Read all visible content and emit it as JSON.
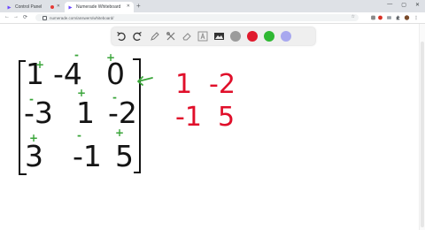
{
  "browser": {
    "tabs": [
      {
        "label": "Control Panel",
        "active": false,
        "recording": true
      },
      {
        "label": "Numerade Whiteboard",
        "active": true,
        "recording": false
      }
    ],
    "new_tab_symbol": "+",
    "url": "numerade.com/answers/whiteboard/",
    "window_controls": [
      "—",
      "▢",
      "✕"
    ],
    "nav": {
      "back": "←",
      "forward": "→",
      "reload": "⟳"
    }
  },
  "toolbar": {
    "tools": [
      "undo-icon",
      "redo-icon",
      "pen-icon",
      "tools-icon",
      "eraser-icon",
      "text-icon",
      "image-icon"
    ],
    "colors": [
      "#9b9b9b",
      "#e01a2d",
      "#2fb833",
      "#a8a8ef"
    ]
  },
  "whiteboard": {
    "matrix": [
      [
        "1",
        "-4",
        "0"
      ],
      [
        "-3",
        "1",
        "-2"
      ],
      [
        "3",
        "-1",
        "5"
      ]
    ],
    "cofactor_signs": [
      [
        "+",
        "-",
        "+"
      ],
      [
        "-",
        "+",
        "-"
      ],
      [
        "+",
        "-",
        "+"
      ]
    ],
    "minor": [
      [
        "1",
        "-2"
      ],
      [
        "-1",
        "5"
      ]
    ]
  }
}
